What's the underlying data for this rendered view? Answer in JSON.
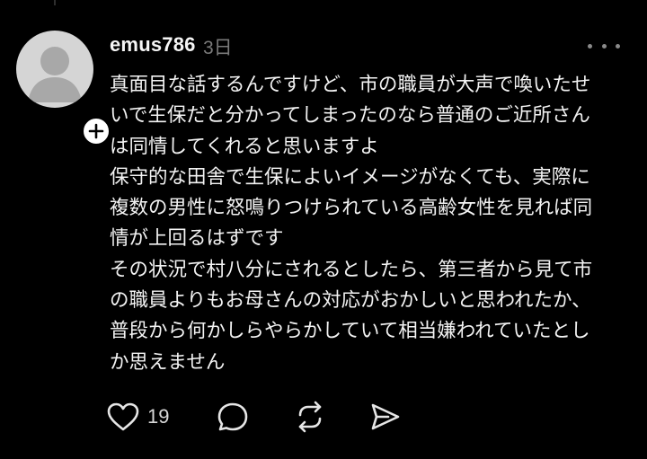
{
  "post": {
    "username": "emus786",
    "timestamp": "3日",
    "body_lines": [
      "真面目な話するんですけど、市の職員が大声で喚いたせ",
      "いで生保だと分かってしまったのなら普通のご近所さん",
      "は同情してくれると思いますよ",
      "保守的な田舎で生保によいイメージがなくても、実際に",
      "複数の男性に怒鳴りつけられている高齢女性を見れば同",
      "情が上回るはずです",
      "その状況で村八分にされるとしたら、第三者から見て市",
      "の職員よりもお母さんの対応がおかしいと思われたか、",
      "普段から何かしらやらかしていて相当嫌われていたとし",
      "か思えません"
    ],
    "like_count": "19"
  },
  "icons": {
    "avatar": "default-avatar-icon",
    "follow": "plus-icon",
    "more": "more-horizontal-icon",
    "like": "heart-icon",
    "reply": "comment-bubble-icon",
    "repost": "repost-icon",
    "share": "send-icon"
  },
  "colors": {
    "background": "#000000",
    "text_primary": "#f3f3f3",
    "text_secondary": "#7a7a7a",
    "avatar_bg": "#d5d5d5",
    "avatar_figure": "#a8a8a8",
    "icon": "#e6e6e6"
  }
}
